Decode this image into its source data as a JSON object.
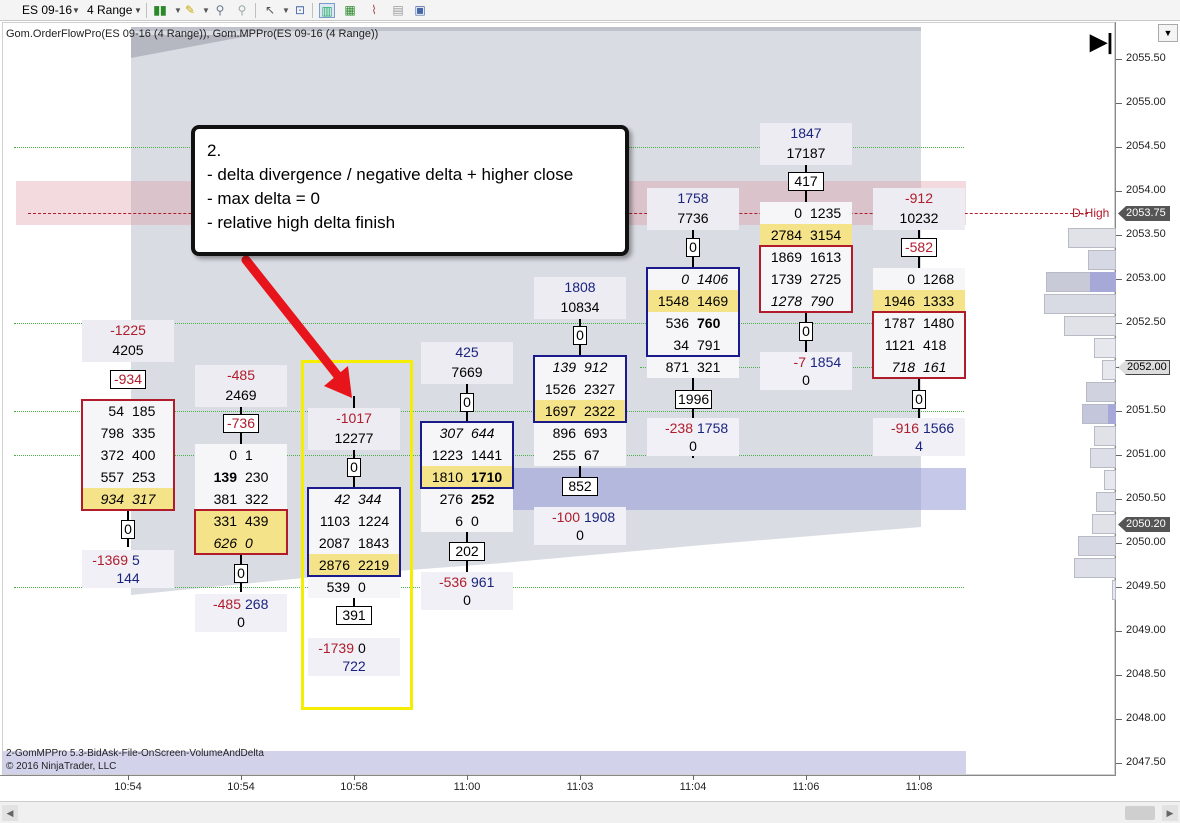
{
  "toolbar": {
    "instrument": "ES 09-16",
    "bar_type": "4 Range"
  },
  "indicator_label": "Gom.OrderFlowPro(ES 09-16 (4 Range)), Gom.MPPro(ES 09-16 (4 Range))",
  "footer": {
    "script_label": "2-GomMPPro 5.3-BidAsk-File-OnScreen-VolumeAndDelta",
    "copyright": "© 2016 NinjaTrader, LLC"
  },
  "annotation": {
    "number": "2.",
    "lines": [
      "- delta divergence / negative delta + higher close",
      "- max delta = 0",
      "- relative high delta finish"
    ]
  },
  "price_axis": {
    "ticks": [
      "2055.50",
      "2055.00",
      "2054.50",
      "2054.00",
      "2053.50",
      "2053.00",
      "2052.50",
      "2052.00",
      "2051.50",
      "2051.00",
      "2050.50",
      "2050.00",
      "2049.50",
      "2049.00",
      "2048.50",
      "2048.00",
      "2047.50"
    ],
    "last_price": "2053.75",
    "current_price": "2052.00",
    "low_price": "2050.20",
    "d_high_label": "D-High"
  },
  "time_axis": [
    "10:54",
    "10:54",
    "10:58",
    "11:00",
    "11:03",
    "11:04",
    "11:06",
    "11:08"
  ],
  "bars": [
    {
      "head_delta": "-1225",
      "head_vol": "4205",
      "delta_box": "-934",
      "cells": [
        [
          "54",
          "185"
        ],
        [
          "798",
          "335"
        ],
        [
          "372",
          "400"
        ],
        [
          "557",
          "253"
        ],
        [
          "934",
          "317"
        ]
      ],
      "tail_box": "0",
      "foot_delta": "-1369",
      "foot_delta2": "5",
      "foot_vol": "144"
    },
    {
      "head_delta": "-485",
      "head_vol": "2469",
      "delta_box": "-736",
      "cells": [
        [
          "0",
          "1"
        ],
        [
          "139",
          "230"
        ],
        [
          "381",
          "322"
        ],
        [
          "331",
          "439"
        ],
        [
          "626",
          "0"
        ]
      ],
      "tail_box": "0",
      "foot_delta": "-485",
      "foot_delta2": "268",
      "foot_vol": "0"
    },
    {
      "head_delta": "-1017",
      "head_vol": "12277",
      "delta_box": "0",
      "cells": [
        [
          "42",
          "344"
        ],
        [
          "1103",
          "1224"
        ],
        [
          "2087",
          "1843"
        ],
        [
          "2876",
          "2219"
        ],
        [
          "539",
          "0"
        ]
      ],
      "tail_box": "391",
      "foot_delta": "-1739",
      "foot_delta2": "0",
      "foot_vol": "722"
    },
    {
      "head_delta": "425",
      "head_vol": "7669",
      "delta_box": "0",
      "cells": [
        [
          "307",
          "644"
        ],
        [
          "1223",
          "1441"
        ],
        [
          "1810",
          "1710"
        ],
        [
          "276",
          "252"
        ],
        [
          "6",
          "0"
        ]
      ],
      "tail_box": "202",
      "foot_delta": "-536",
      "foot_delta2": "961",
      "foot_vol": "0"
    },
    {
      "head_delta": "1808",
      "head_vol": "10834",
      "delta_box": "0",
      "cells": [
        [
          "139",
          "912"
        ],
        [
          "1526",
          "2327"
        ],
        [
          "1697",
          "2322"
        ],
        [
          "896",
          "693"
        ],
        [
          "255",
          "67"
        ]
      ],
      "tail_box": "852",
      "foot_delta": "-100",
      "foot_delta2": "1908",
      "foot_vol": "0"
    },
    {
      "head_delta": "1758",
      "head_vol": "7736",
      "delta_box": "0",
      "cells": [
        [
          "0",
          "1406"
        ],
        [
          "1548",
          "1469"
        ],
        [
          "536",
          "760"
        ],
        [
          "34",
          "791"
        ],
        [
          "871",
          "321"
        ]
      ],
      "tail_box": "1996",
      "foot_delta": "-238",
      "foot_delta2": "1758",
      "foot_vol": "0"
    },
    {
      "head_delta": "1847",
      "head_vol": "17187",
      "delta_box": "417",
      "cells": [
        [
          "0",
          "1235"
        ],
        [
          "2784",
          "3154"
        ],
        [
          "1869",
          "1613"
        ],
        [
          "1739",
          "2725"
        ],
        [
          "1278",
          "790"
        ]
      ],
      "tail_box": "0",
      "foot_delta": "-7",
      "foot_delta2": "1854",
      "foot_vol": "0"
    },
    {
      "head_delta": "-912",
      "head_vol": "10232",
      "delta_box": "-582",
      "cells": [
        [
          "0",
          "1268"
        ],
        [
          "1946",
          "1333"
        ],
        [
          "1787",
          "1480"
        ],
        [
          "1121",
          "418"
        ],
        [
          "718",
          "161"
        ]
      ],
      "tail_box": "0",
      "foot_delta": "-916",
      "foot_delta2": "1566",
      "foot_vol": "4"
    }
  ]
}
